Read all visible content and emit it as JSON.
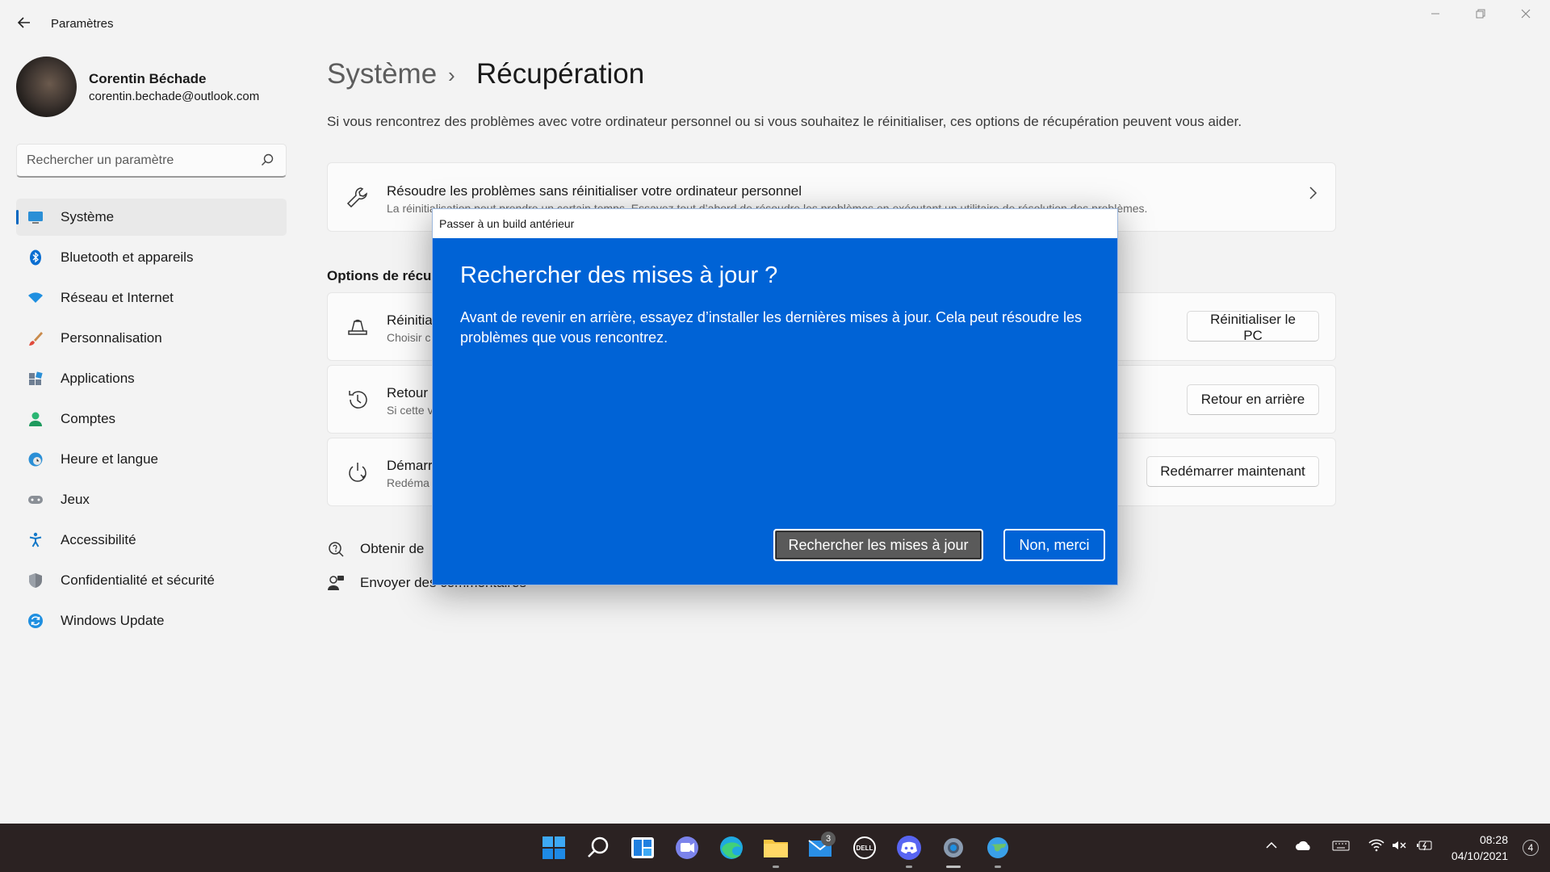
{
  "window": {
    "title": "Paramètres",
    "back_icon": "arrow-left-icon"
  },
  "profile": {
    "name": "Corentin Béchade",
    "email": "corentin.bechade@outlook.com"
  },
  "search": {
    "placeholder": "Rechercher un paramètre"
  },
  "sidebar": {
    "items": [
      {
        "label": "Système",
        "icon": "monitor-icon",
        "active": true
      },
      {
        "label": "Bluetooth et appareils",
        "icon": "bluetooth-icon"
      },
      {
        "label": "Réseau et Internet",
        "icon": "wifi-icon"
      },
      {
        "label": "Personnalisation",
        "icon": "paintbrush-icon"
      },
      {
        "label": "Applications",
        "icon": "apps-icon"
      },
      {
        "label": "Comptes",
        "icon": "person-icon"
      },
      {
        "label": "Heure et langue",
        "icon": "globe-clock-icon"
      },
      {
        "label": "Jeux",
        "icon": "gamepad-icon"
      },
      {
        "label": "Accessibilité",
        "icon": "accessibility-icon"
      },
      {
        "label": "Confidentialité et sécurité",
        "icon": "shield-icon"
      },
      {
        "label": "Windows Update",
        "icon": "update-icon"
      }
    ]
  },
  "main": {
    "breadcrumb_parent": "Système",
    "breadcrumb_separator": "›",
    "breadcrumb_current": "Récupération",
    "description": "Si vous rencontrez des problèmes avec votre ordinateur personnel ou si vous souhaitez le réinitialiser, ces options de récupération peuvent vous aider.",
    "troubleshoot_card": {
      "title": "Résoudre les problèmes sans réinitialiser votre ordinateur personnel",
      "subtitle": "La réinitialisation peut prendre un certain temps. Essayez tout d’abord de résoudre les problèmes en exécutant un utilitaire de résolution des problèmes."
    },
    "section_heading": "Options de récup",
    "options": [
      {
        "title": "Réinitia",
        "subtitle": "Choisir c",
        "button": "Réinitialiser le PC",
        "icon": "reset-pc-icon"
      },
      {
        "title": "Retour",
        "subtitle": "Si cette v",
        "button": "Retour en arrière",
        "icon": "history-icon"
      },
      {
        "title": "Démarr",
        "subtitle": "Redéma",
        "button": "Redémarrer maintenant",
        "icon": "advanced-startup-icon"
      }
    ],
    "links": [
      {
        "label": "Obtenir de",
        "icon": "help-icon"
      },
      {
        "label": "Envoyer des commentaires",
        "icon": "feedback-icon"
      }
    ]
  },
  "dialog": {
    "title": "Passer à un build antérieur",
    "heading": "Rechercher des mises à jour ?",
    "body": "Avant de revenir en arrière, essayez d’installer les dernières mises à jour. Cela peut résoudre les problèmes que vous rencontrez.",
    "primary_button": "Rechercher les mises à jour",
    "secondary_button": "Non, merci",
    "accent_color": "#0063d6"
  },
  "taskbar": {
    "apps": [
      "windows-start-icon",
      "search-icon",
      "widgets-icon",
      "teams-chat-icon",
      "edge-icon",
      "file-explorer-icon",
      "mail-icon",
      "dell-icon",
      "discord-icon",
      "settings-icon",
      "globe-app-icon"
    ],
    "mail_badge": "3",
    "time": "08:28",
    "date": "04/10/2021",
    "notification_count": "4"
  }
}
